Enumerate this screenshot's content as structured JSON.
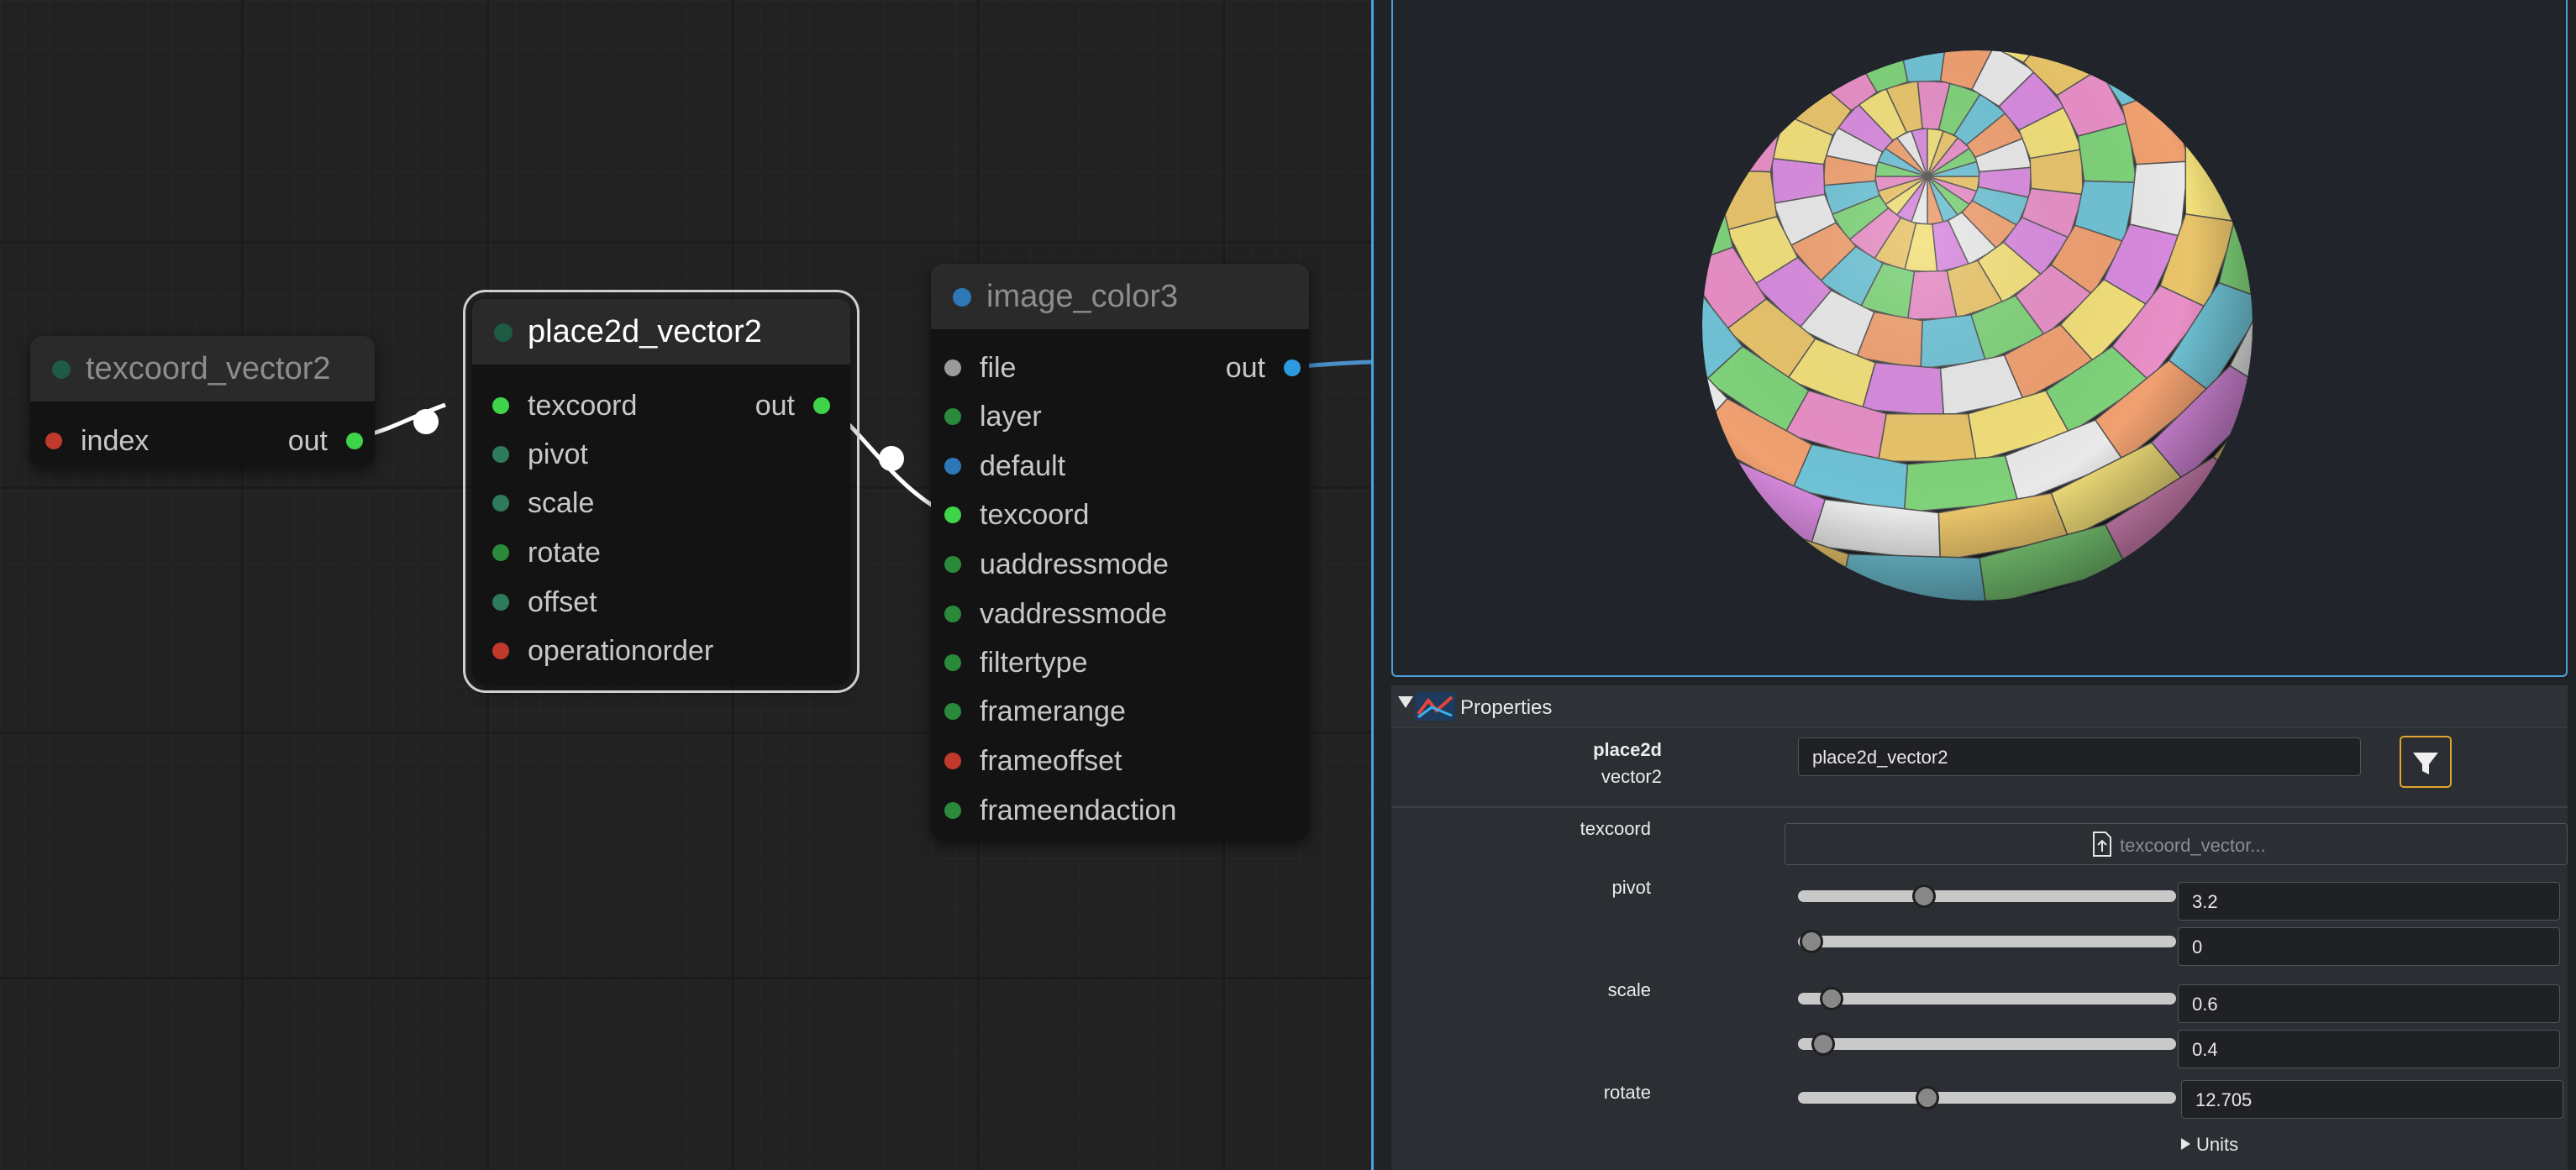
{
  "graph": {
    "nodes": {
      "texcoord": {
        "title": "texcoord_vector2",
        "inputs": [
          "index"
        ],
        "output": "out"
      },
      "place2d": {
        "title": "place2d_vector2",
        "inputs": [
          "texcoord",
          "pivot",
          "scale",
          "rotate",
          "offset",
          "operationorder"
        ],
        "output": "out"
      },
      "image": {
        "title": "image_color3",
        "inputs": [
          "file",
          "layer",
          "default",
          "texcoord",
          "uaddressmode",
          "vaddressmode",
          "filtertype",
          "framerange",
          "frameoffset",
          "frameendaction"
        ],
        "output": "out"
      }
    }
  },
  "viewport": {
    "preview_object": "uv-test-grid-sphere"
  },
  "properties": {
    "title": "Properties",
    "node_category": "place2d",
    "node_type": "vector2",
    "name_value": "place2d_vector2",
    "filter_icon": "filter-icon",
    "texcoord": {
      "label": "texcoord",
      "value": "texcoord_vector..."
    },
    "pivot": {
      "label": "pivot",
      "x": "3.2",
      "y": "0"
    },
    "scale": {
      "label": "scale",
      "x": "0.6",
      "y": "0.4"
    },
    "rotate": {
      "label": "rotate",
      "value": "12.705"
    },
    "units": {
      "label": "Units"
    }
  },
  "colors": {
    "accent": "#4aa3d8",
    "pin_green": "#3fd34a",
    "pin_teal": "#2f7a5a",
    "pin_red": "#c0392b",
    "pin_blue": "#2e78b8",
    "pin_grey": "#9a9a9a",
    "filter_border": "#e1a72b"
  }
}
